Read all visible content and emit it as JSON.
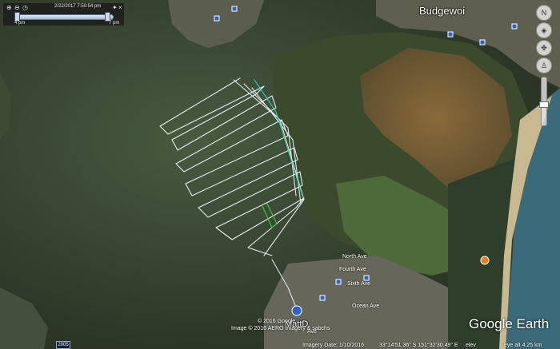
{
  "time_slider": {
    "date_time": "2/22/2017   7:50:54 pm",
    "start_label": "4 pm",
    "end_label": "7 pm",
    "progress": 0.93
  },
  "places": {
    "town": "Budgewoi",
    "pin_label": "MattD"
  },
  "roads": [
    "North Ave",
    "Fourth Ave",
    "Sixth Ave",
    "Ocean Ave",
    "Ave"
  ],
  "copyright": {
    "google": "© 2016 Google",
    "image": "Image © 2016 AERO Imagery & sabchs"
  },
  "status_bar": {
    "imagery_date": "Imagery Date: 1/10/2016",
    "coords": "33°14'51.36\" S  151°32'30.49\" E",
    "elev": "elev",
    "eye_alt": "eye alt   4.25 km"
  },
  "brand": "Google Earth",
  "year_badge": "2005",
  "colors": {
    "water": "#3a4a36",
    "track": "#e8eef2",
    "track_accent": "#2bd4c4",
    "track_green": "#3ccc3c",
    "marker": "#2b63c8"
  }
}
